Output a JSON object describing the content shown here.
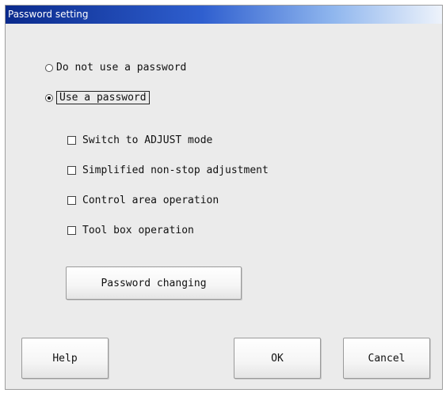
{
  "dialog": {
    "title": "Password setting"
  },
  "password_mode": {
    "options": [
      {
        "label": "Do not use a password",
        "selected": false
      },
      {
        "label": "Use a password",
        "selected": true
      }
    ]
  },
  "protected_operations": [
    {
      "label": "Switch to ADJUST mode",
      "checked": false
    },
    {
      "label": "Simplified non-stop adjustment",
      "checked": false
    },
    {
      "label": "Control area operation",
      "checked": false
    },
    {
      "label": "Tool box operation",
      "checked": false
    }
  ],
  "buttons": {
    "password_changing": "Password changing",
    "help": "Help",
    "ok": "OK",
    "cancel": "Cancel"
  }
}
